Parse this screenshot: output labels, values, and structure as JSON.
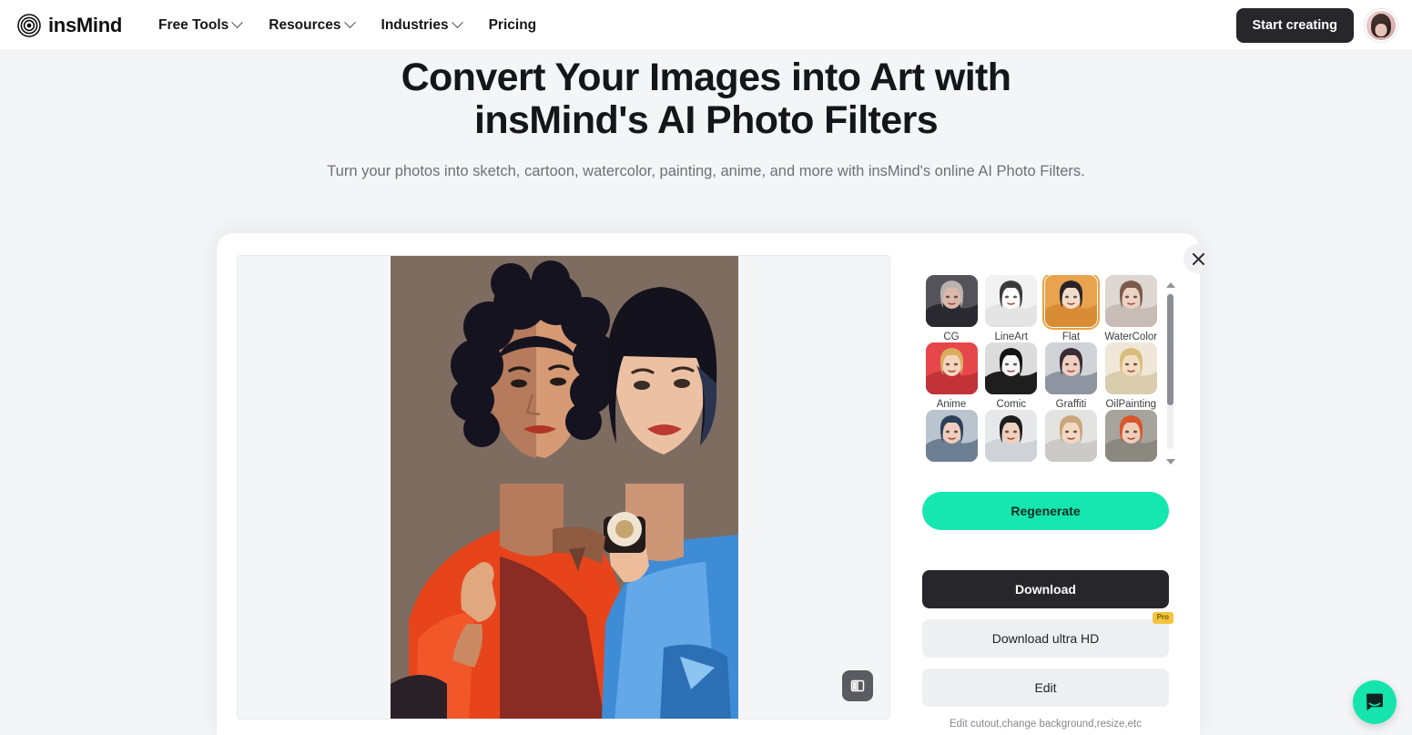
{
  "header": {
    "logo_text": "insMind",
    "logo_icon": "concentric-circles-icon",
    "nav": [
      {
        "label": "Free Tools",
        "has_chevron": true
      },
      {
        "label": "Resources",
        "has_chevron": true
      },
      {
        "label": "Industries",
        "has_chevron": true
      },
      {
        "label": "Pricing",
        "has_chevron": false
      }
    ],
    "cta_label": "Start creating",
    "avatar_name": "user-avatar"
  },
  "hero": {
    "title": "Convert Your Images into Art with insMind's AI Photo Filters",
    "subtitle": "Turn your photos into sketch, cartoon, watercolor, painting, anime, and more with insMind's online AI Photo Filters."
  },
  "editor": {
    "close_icon": "close-icon",
    "compare_icon": "compare-split-icon",
    "filters": [
      {
        "label": "CG",
        "selected": false,
        "c1": "#55535a",
        "c2": "#2b2930",
        "skin": "#d9b8ad",
        "hair": "#b9b2ae"
      },
      {
        "label": "LineArt",
        "selected": false,
        "c1": "#f2f2f2",
        "c2": "#e4e4e4",
        "skin": "#fbfbfb",
        "hair": "#3a3a3a"
      },
      {
        "label": "Flat",
        "selected": true,
        "c1": "#e9a24e",
        "c2": "#d98c36",
        "skin": "#f2ddc9",
        "hair": "#2b2327"
      },
      {
        "label": "WaterColor",
        "selected": false,
        "c1": "#ded7d2",
        "c2": "#c8bdb6",
        "skin": "#ecd2c2",
        "hair": "#7a5b4c"
      },
      {
        "label": "Anime",
        "selected": false,
        "c1": "#e5474b",
        "c2": "#c23239",
        "skin": "#f4d4bd",
        "hair": "#d9ae5e"
      },
      {
        "label": "Comic",
        "selected": false,
        "c1": "#dcdcdc",
        "c2": "#1e1e1e",
        "skin": "#f5f5f5",
        "hair": "#131313"
      },
      {
        "label": "Graffiti",
        "selected": false,
        "c1": "#cfd3d8",
        "c2": "#8e94a0",
        "skin": "#eecfc2",
        "hair": "#3b2b34"
      },
      {
        "label": "OilPainting",
        "selected": false,
        "c1": "#efe8d8",
        "c2": "#d9cdae",
        "skin": "#f3dcc1",
        "hair": "#d9bd7c"
      },
      {
        "label": "",
        "selected": false,
        "c1": "#b9c4cf",
        "c2": "#6d7f92",
        "skin": "#f0cdbc",
        "hair": "#2d4158"
      },
      {
        "label": "",
        "selected": false,
        "c1": "#e6e8ea",
        "c2": "#cfd3d7",
        "skin": "#f0d0be",
        "hair": "#1d1d20"
      },
      {
        "label": "",
        "selected": false,
        "c1": "#e3e3e1",
        "c2": "#cbcac6",
        "skin": "#f2d9c4",
        "hair": "#c9a57a"
      },
      {
        "label": "",
        "selected": false,
        "c1": "#a7a49d",
        "c2": "#8b887f",
        "skin": "#f0cdb8",
        "hair": "#d8562a"
      }
    ],
    "regenerate_label": "Regenerate",
    "download_label": "Download",
    "download_hd_label": "Download ultra HD",
    "pro_badge": "Pro",
    "edit_label": "Edit",
    "edit_hint": "Edit cutout,change background,resize,etc"
  },
  "chat": {
    "icon": "chat-bubble-icon"
  },
  "colors": {
    "accent_green": "#16e7b0",
    "dark": "#26262b",
    "page_bg": "#f4f5f7",
    "selection_orange": "#e8a33d",
    "pro_yellow": "#f2c53d"
  }
}
